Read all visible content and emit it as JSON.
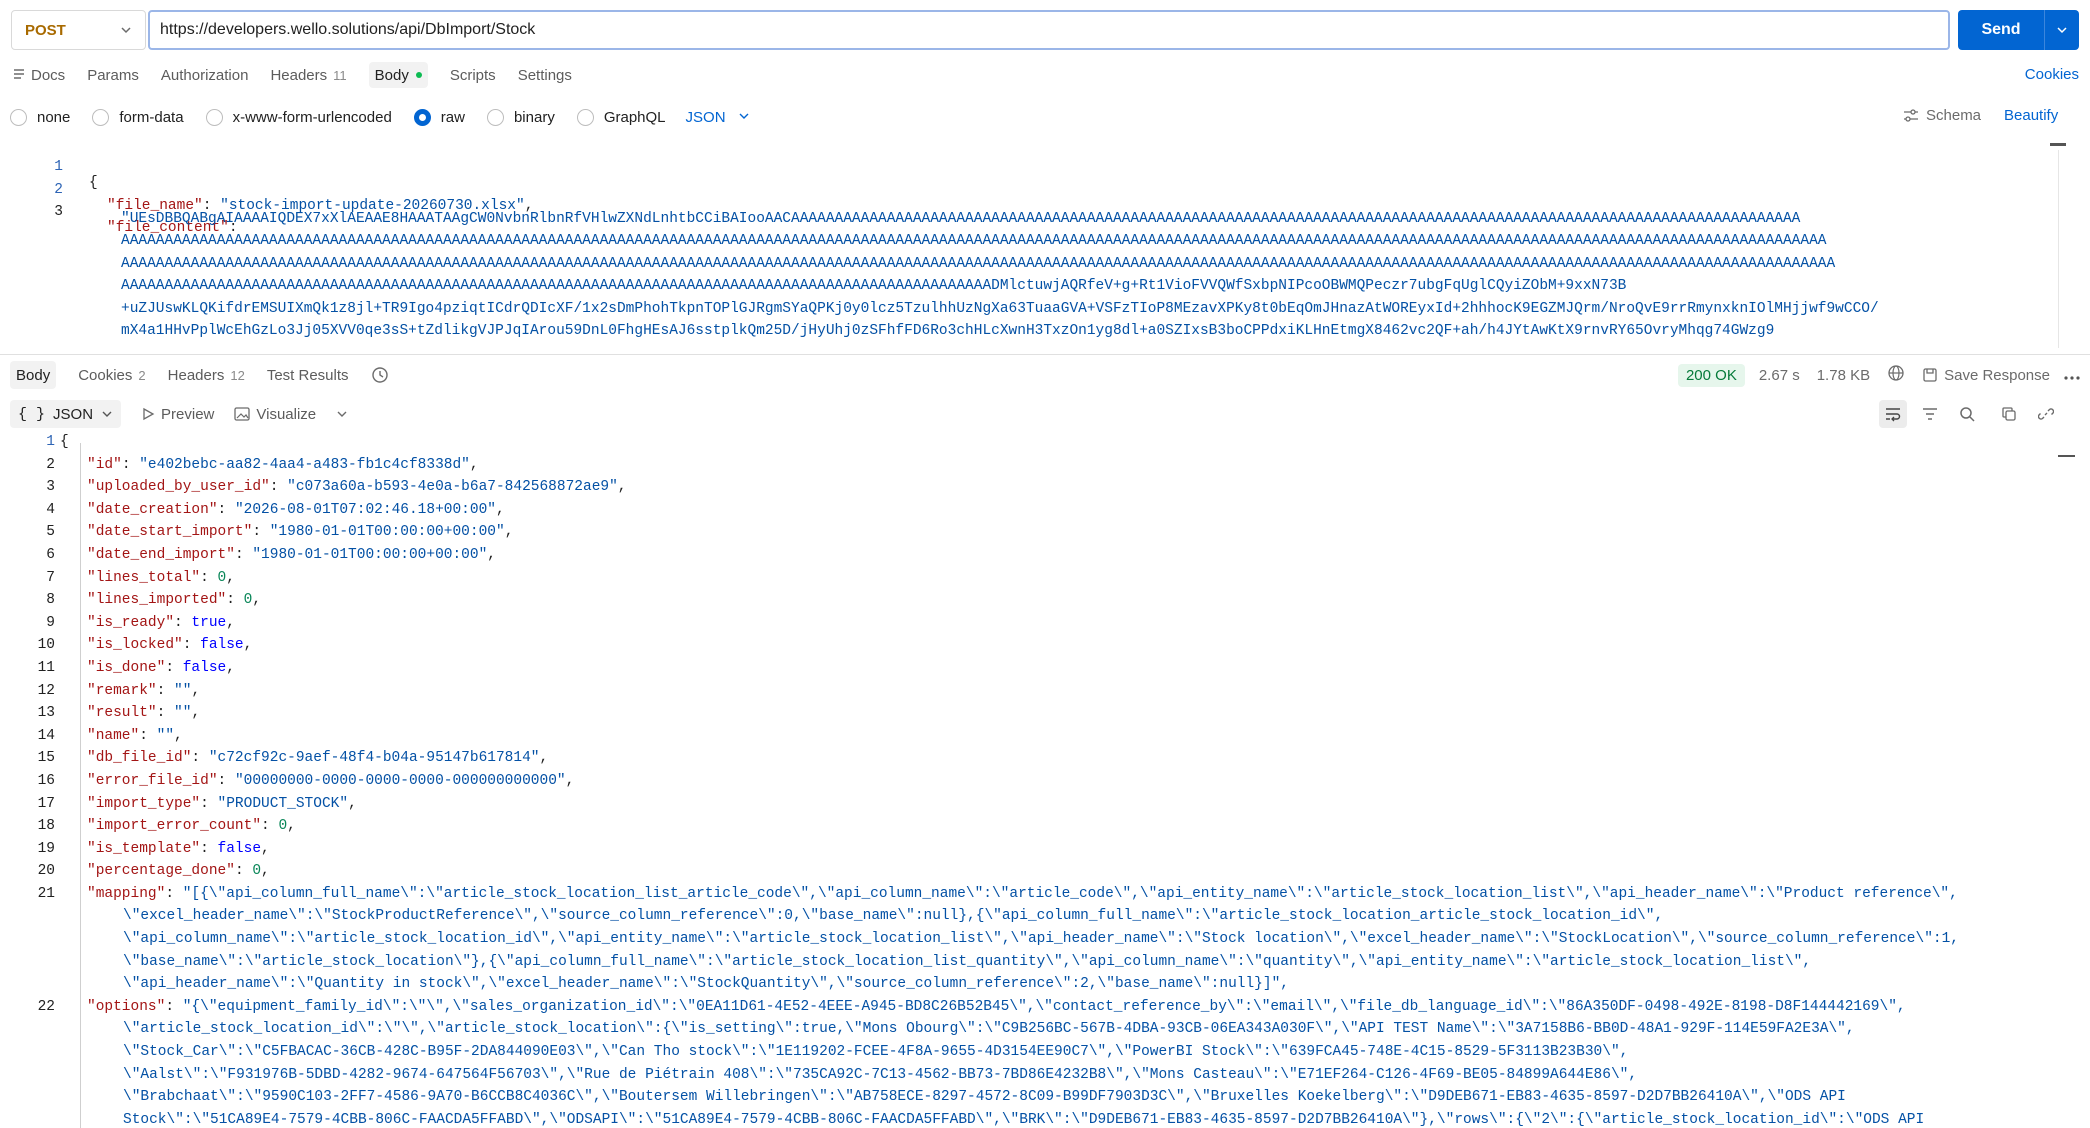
{
  "request": {
    "method": "POST",
    "url": "https://developers.wello.solutions/api/DbImport/Stock",
    "send_label": "Send"
  },
  "req_tabs": [
    {
      "label": "Docs"
    },
    {
      "label": "Params"
    },
    {
      "label": "Authorization"
    },
    {
      "label": "Headers",
      "count": "11"
    },
    {
      "label": "Body"
    },
    {
      "label": "Scripts"
    },
    {
      "label": "Settings"
    }
  ],
  "cookies_label": "Cookies",
  "body_types": [
    "none",
    "form-data",
    "x-www-form-urlencoded",
    "raw",
    "binary",
    "GraphQL"
  ],
  "body_lang": "JSON",
  "schema_label": "Schema",
  "beautify_label": "Beautify",
  "request_body": {
    "line_numbers": [
      "1",
      "2",
      "3"
    ],
    "open_brace": "{",
    "file_name_key": "\"file_name\"",
    "file_name_value": "\"stock-import-update-20260730.xlsx\"",
    "file_content_key": "\"file_content\"",
    "file_content_lines": [
      "\"UEsDBBQABgAIAAAAIQDEX7xXlAEAAE8HAAATAAgCW0NvbnRlbnRfVHlwZXNdLnhtbCCiBAIooAACAAAAAAAAAAAAAAAAAAAAAAAAAAAAAAAAAAAAAAAAAAAAAAAAAAAAAAAAAAAAAAAAAAAAAAAAAAAAAAAAAAAAAAAAAAAAAAAAAAAAAAAAAAAAAAAAAAAA",
      "AAAAAAAAAAAAAAAAAAAAAAAAAAAAAAAAAAAAAAAAAAAAAAAAAAAAAAAAAAAAAAAAAAAAAAAAAAAAAAAAAAAAAAAAAAAAAAAAAAAAAAAAAAAAAAAAAAAAAAAAAAAAAAAAAAAAAAAAAAAAAAAAAAAAAAAAAAAAAAAAAAAAAAAAAAAAAAAAAAAAAAAAAAAAAAAAAAAA",
      "AAAAAAAAAAAAAAAAAAAAAAAAAAAAAAAAAAAAAAAAAAAAAAAAAAAAAAAAAAAAAAAAAAAAAAAAAAAAAAAAAAAAAAAAAAAAAAAAAAAAAAAAAAAAAAAAAAAAAAAAAAAAAAAAAAAAAAAAAAAAAAAAAAAAAAAAAAAAAAAAAAAAAAAAAAAAAAAAAAAAAAAAAAAAAAAAAAAAA",
      "AAAAAAAAAAAAAAAAAAAAAAAAAAAAAAAAAAAAAAAAAAAAAAAAAAAAAAAAAAAAAAAAAAAAAAAAAAAAAAAAAAAAAAAAAAAAAAAAAAAADMlctuwjAQRfeV+g+Rt1VioFVVQWfSxbpNIPcoOBWMQPeczr7ubgFqUglCQyiZObM+9xxN73B",
      "+uZJUswKLQKifdrEMSUIXmQk1z8jl+TR9Igo4pziqtICdrQDIcXF/1x2sDmPhohTkpnTOPlGJRgmSYaQPKj0y0lcz5TzulhhUzNgXa63TuaaGVA+VSFzTIoP8MEzavXPKy8t0bEqOmJHnazAtWOREyxId+2hhhocK9EGZMJQrm/NroQvE9rrRmynxknIOlMHjjwf9wCCO/",
      "mX4a1HHvPplWcEhGzLo3Jj05XVV0qe3sS+tZdlikgVJPJqIArou59DnL0FhgHEsAJ6sstplkQm25D/jHyUhj0zSFhfFD6Ro3chHLcXwnH3TxzOn1yg8dl+a0SZIxsB3boCPPdxiKLHnEtmgX8462vc2QF+ah/h4JYtAwKtX9rnvRY65OvryMhqg74GWzg9"
    ]
  },
  "res_tabs": [
    {
      "label": "Body"
    },
    {
      "label": "Cookies",
      "count": "2"
    },
    {
      "label": "Headers",
      "count": "12"
    },
    {
      "label": "Test Results"
    }
  ],
  "response_meta": {
    "status": "200 OK",
    "time": "2.67 s",
    "size": "1.78 KB",
    "save_label": "Save Response"
  },
  "response_toolbar": {
    "format_braces": "{ }",
    "format": "JSON",
    "preview": "Preview",
    "visualize": "Visualize"
  },
  "response_body": [
    {
      "n": "1",
      "k": "",
      "v": "{",
      "t": "punct"
    },
    {
      "n": "2",
      "k": "\"id\"",
      "v": "\"e402bebc-aa82-4aa4-a483-fb1c4cf8338d\"",
      "t": "str"
    },
    {
      "n": "3",
      "k": "\"uploaded_by_user_id\"",
      "v": "\"c073a60a-b593-4e0a-b6a7-842568872ae9\"",
      "t": "str"
    },
    {
      "n": "4",
      "k": "\"date_creation\"",
      "v": "\"2026-08-01T07:02:46.18+00:00\"",
      "t": "str"
    },
    {
      "n": "5",
      "k": "\"date_start_import\"",
      "v": "\"1980-01-01T00:00:00+00:00\"",
      "t": "str"
    },
    {
      "n": "6",
      "k": "\"date_end_import\"",
      "v": "\"1980-01-01T00:00:00+00:00\"",
      "t": "str"
    },
    {
      "n": "7",
      "k": "\"lines_total\"",
      "v": "0",
      "t": "num"
    },
    {
      "n": "8",
      "k": "\"lines_imported\"",
      "v": "0",
      "t": "num"
    },
    {
      "n": "9",
      "k": "\"is_ready\"",
      "v": "true",
      "t": "kw"
    },
    {
      "n": "10",
      "k": "\"is_locked\"",
      "v": "false",
      "t": "kw"
    },
    {
      "n": "11",
      "k": "\"is_done\"",
      "v": "false",
      "t": "kw"
    },
    {
      "n": "12",
      "k": "\"remark\"",
      "v": "\"\"",
      "t": "str"
    },
    {
      "n": "13",
      "k": "\"result\"",
      "v": "\"\"",
      "t": "str"
    },
    {
      "n": "14",
      "k": "\"name\"",
      "v": "\"\"",
      "t": "str"
    },
    {
      "n": "15",
      "k": "\"db_file_id\"",
      "v": "\"c72cf92c-9aef-48f4-b04a-95147b617814\"",
      "t": "str"
    },
    {
      "n": "16",
      "k": "\"error_file_id\"",
      "v": "\"00000000-0000-0000-0000-000000000000\"",
      "t": "str"
    },
    {
      "n": "17",
      "k": "\"import_type\"",
      "v": "\"PRODUCT_STOCK\"",
      "t": "str"
    },
    {
      "n": "18",
      "k": "\"import_error_count\"",
      "v": "0",
      "t": "num"
    },
    {
      "n": "19",
      "k": "\"is_template\"",
      "v": "false",
      "t": "kw"
    },
    {
      "n": "20",
      "k": "\"percentage_done\"",
      "v": "0",
      "t": "num"
    },
    {
      "n": "21",
      "k": "\"mapping\"",
      "v": "\"[{\\\"api_column_full_name\\\":\\\"article_stock_location_list_article_code\\\",\\\"api_column_name\\\":\\\"article_code\\\",\\\"api_entity_name\\\":\\\"article_stock_location_list\\\",\\\"api_header_name\\\":\\\"Product reference\\\",",
      "t": "str",
      "cont": [
        "\\\"excel_header_name\\\":\\\"StockProductReference\\\",\\\"source_column_reference\\\":0,\\\"base_name\\\":null},{\\\"api_column_full_name\\\":\\\"article_stock_location_article_stock_location_id\\\",",
        "\\\"api_column_name\\\":\\\"article_stock_location_id\\\",\\\"api_entity_name\\\":\\\"article_stock_location_list\\\",\\\"api_header_name\\\":\\\"Stock location\\\",\\\"excel_header_name\\\":\\\"StockLocation\\\",\\\"source_column_reference\\\":1,",
        "\\\"base_name\\\":\\\"article_stock_location\\\"},{\\\"api_column_full_name\\\":\\\"article_stock_location_list_quantity\\\",\\\"api_column_name\\\":\\\"quantity\\\",\\\"api_entity_name\\\":\\\"article_stock_location_list\\\",",
        "\\\"api_header_name\\\":\\\"Quantity in stock\\\",\\\"excel_header_name\\\":\\\"StockQuantity\\\",\\\"source_column_reference\\\":2,\\\"base_name\\\":null}]\","
      ]
    },
    {
      "n": "22",
      "k": "\"options\"",
      "v": "\"{\\\"equipment_family_id\\\":\\\"\\\",\\\"sales_organization_id\\\":\\\"0EA11D61-4E52-4EEE-A945-BD8C26B52B45\\\",\\\"contact_reference_by\\\":\\\"email\\\",\\\"file_db_language_id\\\":\\\"86A350DF-0498-492E-8198-D8F144442169\\\",",
      "t": "str",
      "cont": [
        "\\\"article_stock_location_id\\\":\\\"\\\",\\\"article_stock_location\\\":{\\\"is_setting\\\":true,\\\"Mons Obourg\\\":\\\"C9B256BC-567B-4DBA-93CB-06EA343A030F\\\",\\\"API TEST Name\\\":\\\"3A7158B6-BB0D-48A1-929F-114E59FA2E3A\\\",",
        "\\\"Stock_Car\\\":\\\"C5FBACAC-36CB-428C-B95F-2DA844090E03\\\",\\\"Can Tho stock\\\":\\\"1E119202-FCEE-4F8A-9655-4D3154EE90C7\\\",\\\"PowerBI Stock\\\":\\\"639FCA45-748E-4C15-8529-5F3113B23B30\\\",",
        "\\\"Aalst\\\":\\\"F931976B-5DBD-4282-9674-647564F56703\\\",\\\"Rue de Piétrain 408\\\":\\\"735CA92C-7C13-4562-BB73-7BD86E4232B8\\\",\\\"Mons Casteau\\\":\\\"E71EF264-C126-4F69-BE05-84899A644E86\\\",",
        "\\\"Brabchaat\\\":\\\"9590C103-2FF7-4586-9A70-B6CCB8C4036C\\\",\\\"Boutersem Willebringen\\\":\\\"AB758ECE-8297-4572-8C09-B99DF7903D3C\\\",\\\"Bruxelles Koekelberg\\\":\\\"D9DEB671-EB83-4635-8597-D2D7BB26410A\\\",\\\"ODS API",
        "Stock\\\":\\\"51CA89E4-7579-4CBB-806C-FAACDA5FFABD\\\",\\\"ODSAPI\\\":\\\"51CA89E4-7579-4CBB-806C-FAACDA5FFABD\\\",\\\"BRK\\\":\\\"D9DEB671-EB83-4635-8597-D2D7BB26410A\\\"},\\\"rows\\\":{\\\"2\\\":{\\\"article_stock_location_id\\\":\\\"ODS API"
      ]
    }
  ]
}
